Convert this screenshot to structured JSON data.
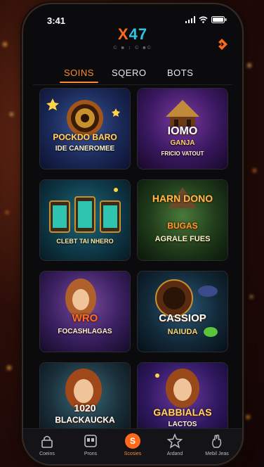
{
  "status": {
    "time": "3:41"
  },
  "brand": {
    "logo_x": "X",
    "logo_num": "47",
    "tagline": "© ■ ↕ © ■©"
  },
  "tabs": [
    {
      "label": "SOINS",
      "active": true
    },
    {
      "label": "SQERO",
      "active": false
    },
    {
      "label": "BOTS",
      "active": false
    }
  ],
  "games": [
    {
      "line1": "POCKDO BARO",
      "line2": "IDE CANEROMEE"
    },
    {
      "line1": "IOMO",
      "line2": "GANJA",
      "line3": "FRICIO VATOUT"
    },
    {
      "line1": "",
      "line2": "CLEBT TAI NHERO"
    },
    {
      "line1": "HARN DONO",
      "line2": "BUGAS",
      "line3": "AGRALE FUES"
    },
    {
      "line1": "WRO",
      "line2": "FOCASHLAGAS"
    },
    {
      "line1": "CASSIOP",
      "line2": "NAIUDA"
    },
    {
      "line1": "1020",
      "line2": "BLACKAUCKA"
    },
    {
      "line1": "GABBIALAS",
      "line2": "LACTOS"
    }
  ],
  "nav": [
    {
      "label": "Coeins",
      "icon": "lock-icon"
    },
    {
      "label": "Prons",
      "icon": "slot-machine-icon"
    },
    {
      "label": "Scosies",
      "icon": "casino-chip-icon",
      "center_glyph": "S"
    },
    {
      "label": "Ardand",
      "icon": "star-icon"
    },
    {
      "label": "Mebil Jeas",
      "icon": "hand-icon"
    }
  ]
}
